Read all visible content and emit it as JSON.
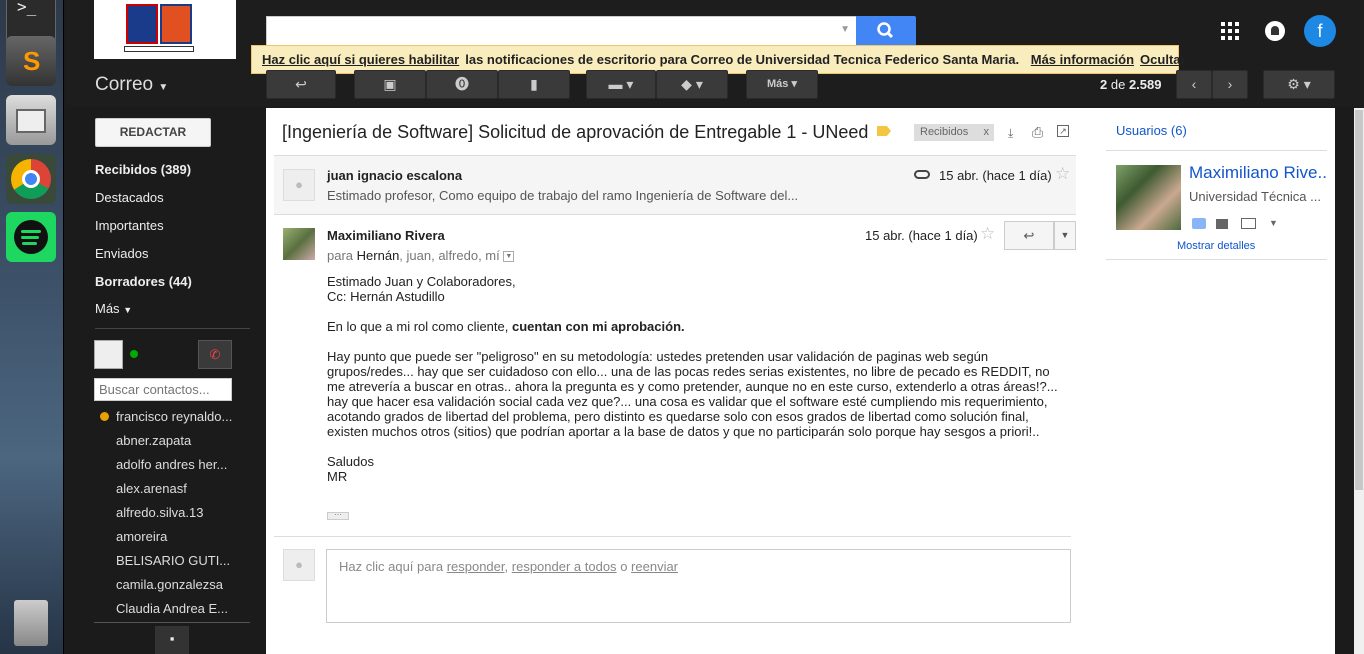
{
  "header": {
    "notification_link": "Haz clic aquí si quieres habilitar",
    "notification_text": "las notificaciones de escritorio para Correo de Universidad Tecnica Federico Santa Maria.",
    "more_info": "Más información",
    "hide": "Ocultar",
    "avatar_letter": "f"
  },
  "toolbar": {
    "more_label": "Más",
    "pagination_current": "2",
    "pagination_of": "de",
    "pagination_total": "2.589"
  },
  "nav": {
    "app_title": "Correo",
    "compose": "REDACTAR",
    "items": [
      "Recibidos (389)",
      "Destacados",
      "Importantes",
      "Enviados",
      "Borradores (44)",
      "Más"
    ],
    "search_contacts_placeholder": "Buscar contactos...",
    "contacts": [
      "francisco reynaldo...",
      "abner.zapata",
      "adolfo andres her...",
      "alex.arenasf",
      "alfredo.silva.13",
      "amoreira",
      "BELISARIO GUTI...",
      "camila.gonzalezsa",
      "Claudia Andrea E..."
    ]
  },
  "thread": {
    "subject": "[Ingeniería de Software] Solicitud de aprovación de Entregable 1 - UNeed",
    "label": "Recibidos",
    "label_close": "x",
    "msg1": {
      "sender": "juan ignacio escalona",
      "date": "15 abr. (hace 1 día)",
      "snippet": "Estimado profesor, Como equipo de trabajo del ramo Ingeniería de Software del..."
    },
    "msg2": {
      "sender": "Maximiliano Rivera",
      "date": "15 abr. (hace 1 día)",
      "to_prefix": "para",
      "to_main": "Hernán",
      "to_rest": ", juan, alfredo, mí",
      "body_l1": "Estimado Juan y Colaboradores,",
      "body_l2": "Cc: Hernán Astudillo",
      "body_p2_pre": "En lo que a mi rol como cliente, ",
      "body_p2_bold": "cuentan con mi aprobación.",
      "body_p3": "Hay punto que puede ser \"peligroso\" en su metodología: ustedes pretenden usar validación de paginas web según grupos/redes... hay que ser cuidadoso con ello... una de las pocas redes serias existentes, no libre de pecado es REDDIT, no me atrevería a buscar en otras.. ahora la pregunta es y como pretender, aunque no en este curso, extenderlo a otras áreas!?... hay que hacer esa validación social cada vez que?... una cosa es validar que el software esté cumpliendo mis requerimiento, acotando grados de libertad del problema, pero distinto es quedarse solo con esos grados de libertad como solución final, existen muchos otros (sitios) que podrían aportar a la base de datos y que no participarán solo porque hay sesgos a priori!..",
      "sign1": "Saludos",
      "sign2": "MR"
    },
    "reply": {
      "pre": "Haz clic aquí para",
      "reply": "responder",
      "sep": ",",
      "reply_all": "responder a todos",
      "or": "o",
      "forward": "reenviar"
    }
  },
  "sidebar": {
    "users": "Usuarios (6)",
    "name": "Maximiliano Rive...",
    "org": "Universidad Técnica ...",
    "details": "Mostrar detalles"
  },
  "colors": {
    "accent": "#4285f4",
    "header_bg": "#1d1d1d",
    "notif_bg": "#f9edbe"
  }
}
